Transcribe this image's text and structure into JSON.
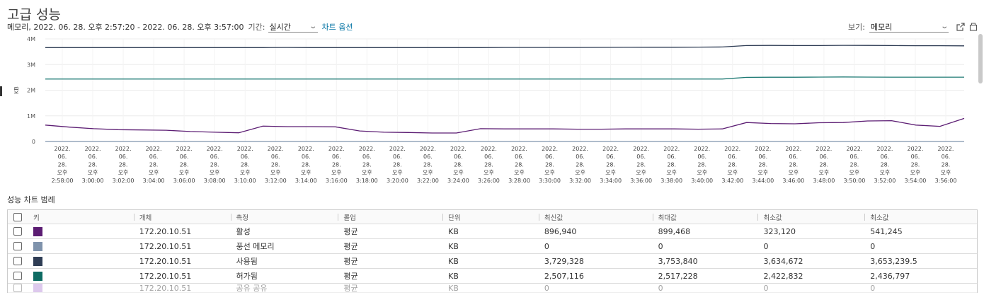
{
  "title": "고급 성능",
  "subbar": {
    "range": "메모리, 2022. 06. 28. 오후 2:57:20 - 2022. 06. 28. 오후 3:57:00",
    "period_label": "기간:",
    "period_value": "실시간",
    "chart_options": "차트 옵션"
  },
  "view": {
    "label": "보기:",
    "value": "메모리"
  },
  "icons": [
    "popout-icon",
    "export-icon",
    "chevron-down-icon"
  ],
  "chart_data": {
    "type": "line",
    "ylabel": "KB",
    "y_ticks": [
      "0",
      "1M",
      "2M",
      "3M",
      "4M"
    ],
    "ylim": [
      0,
      4000000
    ],
    "grid": true,
    "legend": "table below chart",
    "x_labels": [
      "2:58:00",
      "3:00:00",
      "3:02:00",
      "3:04:00",
      "3:06:00",
      "3:08:00",
      "3:10:00",
      "3:12:00",
      "3:14:00",
      "3:16:00",
      "3:18:00",
      "3:20:00",
      "3:22:00",
      "3:24:00",
      "3:26:00",
      "3:28:00",
      "3:30:00",
      "3:32:00",
      "3:34:00",
      "3:36:00",
      "3:38:00",
      "3:40:00",
      "3:42:00",
      "3:44:00",
      "3:46:00",
      "3:48:00",
      "3:50:00",
      "3:52:00",
      "3:54:00",
      "3:56:00"
    ],
    "x_label_prefix": [
      "2022.",
      "06.",
      "28.",
      "오후"
    ],
    "series": [
      {
        "name": "사용됨",
        "color": "#2f3d55",
        "values": [
          3660000,
          3660000,
          3660000,
          3660000,
          3660000,
          3660000,
          3660000,
          3660000,
          3660000,
          3660000,
          3665000,
          3660000,
          3660000,
          3660000,
          3660000,
          3660000,
          3660000,
          3660000,
          3660000,
          3665000,
          3665000,
          3665000,
          3665000,
          3670000,
          3672000,
          3675000,
          3675000,
          3680000,
          3685000,
          3740000,
          3745000,
          3740000,
          3740000,
          3750000,
          3745000,
          3740000,
          3735000,
          3735000,
          3730000
        ]
      },
      {
        "name": "허가됨",
        "color": "#1e7a74",
        "values": [
          2437000,
          2437000,
          2437000,
          2437000,
          2437000,
          2437000,
          2437000,
          2437000,
          2437000,
          2437000,
          2437000,
          2437000,
          2437000,
          2437000,
          2437000,
          2437000,
          2437000,
          2437000,
          2437000,
          2437000,
          2437000,
          2437000,
          2437000,
          2437000,
          2437000,
          2437000,
          2437000,
          2437000,
          2437000,
          2500000,
          2505000,
          2505000,
          2510000,
          2515000,
          2510000,
          2508000,
          2507000,
          2507000,
          2507000
        ]
      },
      {
        "name": "활성",
        "color": "#5c1d73",
        "values": [
          640000,
          560000,
          500000,
          460000,
          450000,
          440000,
          390000,
          360000,
          340000,
          600000,
          580000,
          580000,
          570000,
          410000,
          360000,
          350000,
          330000,
          330000,
          500000,
          490000,
          490000,
          490000,
          480000,
          480000,
          490000,
          490000,
          490000,
          480000,
          490000,
          740000,
          700000,
          690000,
          730000,
          740000,
          800000,
          810000,
          640000,
          590000,
          900000
        ]
      },
      {
        "name": "풍선 메모리",
        "color": "#7f93ac",
        "values": [
          0,
          0,
          0,
          0,
          0,
          0,
          0,
          0,
          0,
          0,
          0,
          0,
          0,
          0,
          0,
          0,
          0,
          0,
          0,
          0,
          0,
          0,
          0,
          0,
          0,
          0,
          0,
          0,
          0,
          0,
          0,
          0,
          0,
          0,
          0,
          0,
          0,
          0,
          0
        ]
      }
    ]
  },
  "legend": {
    "title": "성능 차트 범례",
    "headers": [
      "키",
      "개체",
      "측정",
      "롤업",
      "단위",
      "최신값",
      "최대값",
      "최소값",
      "최소값"
    ],
    "rows": [
      {
        "color": "#5c1d73",
        "object": "172.20.10.51",
        "measure": "활성",
        "rollup": "평균",
        "unit": "KB",
        "latest": "896,940",
        "max": "899,468",
        "min": "323,120",
        "avg": "541,245"
      },
      {
        "color": "#7f93ac",
        "object": "172.20.10.51",
        "measure": "풍선 메모리",
        "rollup": "평균",
        "unit": "KB",
        "latest": "0",
        "max": "0",
        "min": "0",
        "avg": "0"
      },
      {
        "color": "#2f3d55",
        "object": "172.20.10.51",
        "measure": "사용됨",
        "rollup": "평균",
        "unit": "KB",
        "latest": "3,729,328",
        "max": "3,753,840",
        "min": "3,634,672",
        "avg": "3,653,239.5"
      },
      {
        "color": "#0e6b63",
        "object": "172.20.10.51",
        "measure": "허가됨",
        "rollup": "평균",
        "unit": "KB",
        "latest": "2,507,116",
        "max": "2,517,228",
        "min": "2,422,832",
        "avg": "2,436,797"
      },
      {
        "color": "#b48ad8",
        "object": "172.20.10.51",
        "measure": "공유 공유",
        "rollup": "평균",
        "unit": "KB",
        "latest": "0",
        "max": "0",
        "min": "0",
        "avg": "0"
      }
    ]
  }
}
